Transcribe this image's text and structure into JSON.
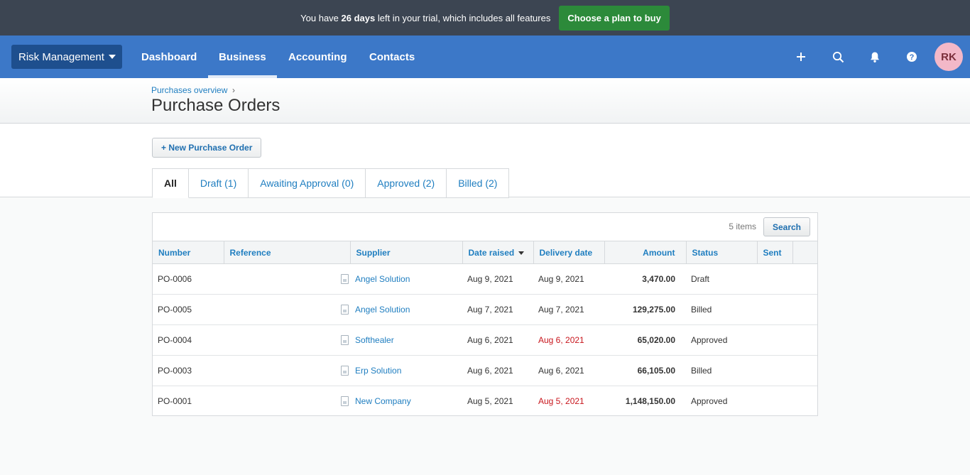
{
  "banner": {
    "text_before": "You have ",
    "days": "26 days",
    "text_after": " left in your trial, which includes all features",
    "button": "Choose a plan to buy"
  },
  "nav": {
    "org": "Risk Management",
    "items": [
      "Dashboard",
      "Business",
      "Accounting",
      "Contacts"
    ],
    "active": "Business",
    "icons": [
      "plus-icon",
      "search-icon",
      "bell-icon",
      "help-icon"
    ],
    "avatar": "RK"
  },
  "page": {
    "breadcrumb": "Purchases overview",
    "breadcrumb_sep": "›",
    "title": "Purchase Orders",
    "new_button": "+ New Purchase Order"
  },
  "tabs": [
    "All",
    "Draft (1)",
    "Awaiting Approval (0)",
    "Approved (2)",
    "Billed (2)"
  ],
  "active_tab": "All",
  "table": {
    "count": "5 items",
    "search": "Search",
    "columns": [
      "Number",
      "Reference",
      "Supplier",
      "Date raised",
      "Delivery date",
      "Amount",
      "Status",
      "Sent"
    ],
    "rows": [
      {
        "number": "PO-0006",
        "reference": "",
        "supplier": "Angel Solution",
        "date_raised": "Aug 9, 2021",
        "delivery": "Aug 9, 2021",
        "overdue": false,
        "amount": "3,470.00",
        "status": "Draft",
        "sent": ""
      },
      {
        "number": "PO-0005",
        "reference": "",
        "supplier": "Angel Solution",
        "date_raised": "Aug 7, 2021",
        "delivery": "Aug 7, 2021",
        "overdue": false,
        "amount": "129,275.00",
        "status": "Billed",
        "sent": ""
      },
      {
        "number": "PO-0004",
        "reference": "",
        "supplier": "Softhealer",
        "date_raised": "Aug 6, 2021",
        "delivery": "Aug 6, 2021",
        "overdue": true,
        "amount": "65,020.00",
        "status": "Approved",
        "sent": ""
      },
      {
        "number": "PO-0003",
        "reference": "",
        "supplier": "Erp Solution",
        "date_raised": "Aug 6, 2021",
        "delivery": "Aug 6, 2021",
        "overdue": false,
        "amount": "66,105.00",
        "status": "Billed",
        "sent": ""
      },
      {
        "number": "PO-0001",
        "reference": "",
        "supplier": "New Company",
        "date_raised": "Aug 5, 2021",
        "delivery": "Aug 5, 2021",
        "overdue": true,
        "amount": "1,148,150.00",
        "status": "Approved",
        "sent": ""
      }
    ]
  },
  "colors": {
    "banner_bg": "#3c4552",
    "nav_bg": "#3c78c8",
    "link": "#1f7ec0",
    "cta_green": "#2c8a3a",
    "overdue_red": "#c8161d"
  }
}
